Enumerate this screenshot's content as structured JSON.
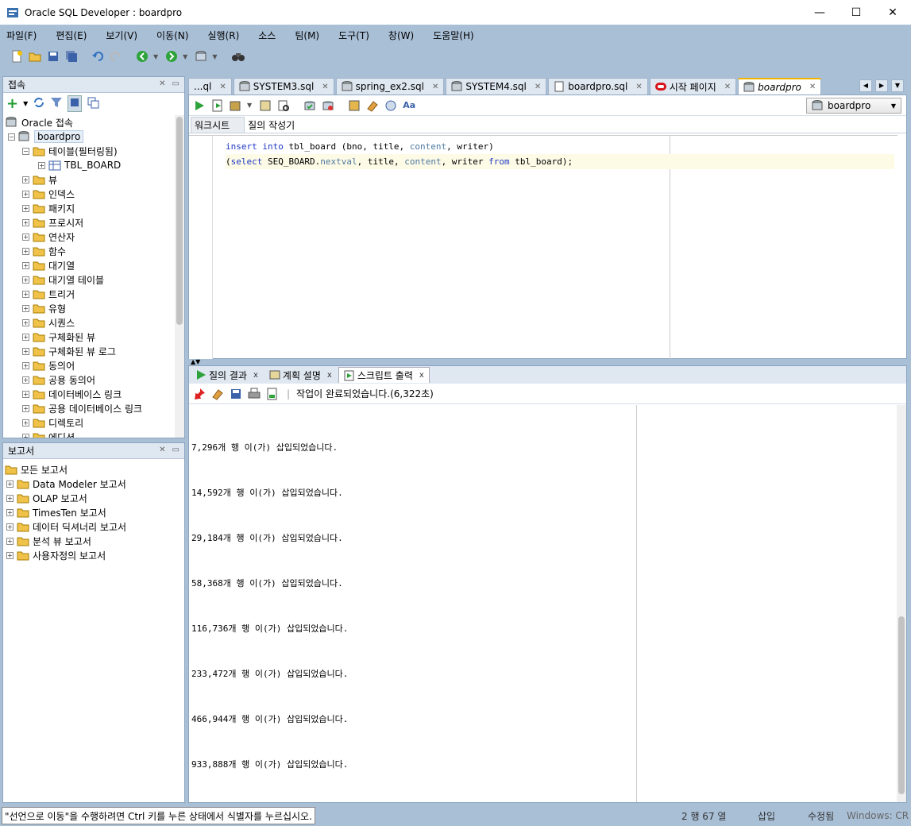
{
  "window": {
    "title": "Oracle SQL Developer : boardpro",
    "minimize": "—",
    "maximize": "☐",
    "close": "✕"
  },
  "menu": [
    "파일(F)",
    "편집(E)",
    "보기(V)",
    "이동(N)",
    "실행(R)",
    "소스",
    "팀(M)",
    "도구(T)",
    "창(W)",
    "도움말(H)"
  ],
  "connections_panel": {
    "title": "접속",
    "root": "Oracle 접속",
    "connection": "boardpro",
    "tables_folder": "테이블(필터링됨)",
    "table": "TBL_BOARD",
    "folders": [
      "뷰",
      "인덱스",
      "패키지",
      "프로시저",
      "연산자",
      "함수",
      "대기열",
      "대기열 테이블",
      "트리거",
      "유형",
      "시퀀스",
      "구체화된 뷰",
      "구체화된 뷰 로그",
      "동의어",
      "공용 동의어",
      "데이터베이스 링크",
      "공용 데이터베이스 링크",
      "디렉토리",
      "에디션"
    ]
  },
  "reports_panel": {
    "title": "보고서",
    "root": "모든 보고서",
    "items": [
      "Data Modeler 보고서",
      "OLAP 보고서",
      "TimesTen 보고서",
      "데이터 딕셔너리 보고서",
      "분석 뷰 보고서",
      "사용자정의 보고서"
    ]
  },
  "doc_tabs": [
    {
      "label": "...ql",
      "icon": ""
    },
    {
      "label": "SYSTEM3.sql",
      "icon": "sql-icon"
    },
    {
      "label": "spring_ex2.sql",
      "icon": "sql-icon"
    },
    {
      "label": "SYSTEM4.sql",
      "icon": "sql-icon"
    },
    {
      "label": "boardpro.sql",
      "icon": "file-icon"
    },
    {
      "label": "시작 페이지",
      "icon": "oracle-icon"
    },
    {
      "label": "boardpro",
      "icon": "db-icon"
    }
  ],
  "editor": {
    "connection": "boardpro",
    "subtabs": [
      "워크시트",
      "질의 작성기"
    ],
    "code": {
      "l1_kw1": "insert into",
      "l1_rest": " tbl_board (bno, title, ",
      "l1_content": "content",
      "l1_end": ", writer)",
      "l2_open": "(",
      "l2_select": "select",
      "l2_seq": " SEQ_BOARD.",
      "l2_nextval": "nextval",
      "l2_mid": ", title, ",
      "l2_content": "content",
      "l2_mid2": ", writer ",
      "l2_from": "from",
      "l2_end": " tbl_board);"
    }
  },
  "results": {
    "tabs": [
      "질의 결과",
      "계획 설명",
      "스크립트 출력"
    ],
    "status": "작업이 완료되었습니다.(6,322초)",
    "lines": [
      "7,296개 행 이(가) 삽입되었습니다.",
      "14,592개 행 이(가) 삽입되었습니다.",
      "29,184개 행 이(가) 삽입되었습니다.",
      "58,368개 행 이(가) 삽입되었습니다.",
      "116,736개 행 이(가) 삽입되었습니다.",
      "233,472개 행 이(가) 삽입되었습니다.",
      "466,944개 행 이(가) 삽입되었습니다.",
      "933,888개 행 이(가) 삽입되었습니다."
    ]
  },
  "statusbar": {
    "message": "\"선언으로 이동\"을 수행하려면 Ctrl 키를 누른 상태에서 식별자를 누르십시오.",
    "position": "2 행 67 열",
    "mode": "삽입",
    "state": "수정됨",
    "platform": "Windows: CR"
  }
}
